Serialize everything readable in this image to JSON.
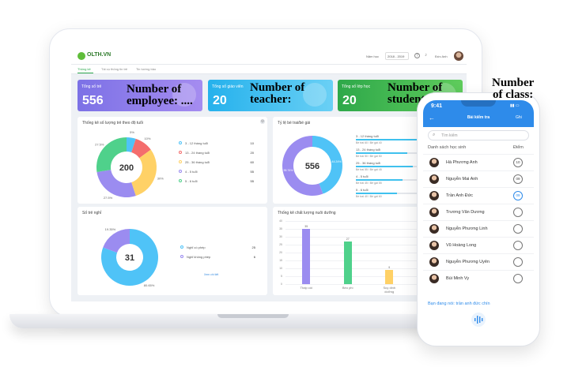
{
  "app": {
    "logo_text": "OLTH.VN",
    "school_year_label": "Năm học",
    "school_year_value": "2018 - 2019",
    "user_name": "Đức Anh",
    "tabs": [
      "Thông kê",
      "Tài vụ thông tin trẻ",
      "Tin tường bảo"
    ]
  },
  "cards": [
    {
      "label": "Tổng số trẻ",
      "value": "556",
      "color": "#7c71e6"
    },
    {
      "label": "Tổng số giáo viên",
      "value": "20",
      "color": "#25b1ec"
    },
    {
      "label": "Tổng số lớp học",
      "value": "20",
      "color": "#2ea84a"
    }
  ],
  "annotations": {
    "employee": [
      "Number of",
      "employee: ...."
    ],
    "teacher": [
      "Number of",
      "teacher:"
    ],
    "student": [
      "Number of",
      "student"
    ],
    "class": [
      "Number",
      "of class:"
    ]
  },
  "panels": {
    "age_title": "Thống kê số lượng trẻ theo độ tuổi",
    "ratio_title": "Tỷ lệ bé trai/bé gái",
    "absent_title": "Số trẻ nghỉ",
    "nutrition_title": "Thống kê chất lượng nuôi dưỡng",
    "absent_link": "Xem chi tiết"
  },
  "chart_data": [
    {
      "type": "pie",
      "title": "Thống kê số lượng trẻ theo độ tuổi",
      "center_label": "200",
      "categories": [
        "3 - 12 tháng tuổi",
        "13 - 24 tháng tuổi",
        "25 - 36 tháng tuổi",
        "4 - 5 tuổi",
        "5 - 6 tuổi"
      ],
      "values": [
        10,
        20,
        60,
        55,
        55
      ],
      "slice_labels": [
        "5%",
        "10%",
        "30%",
        "27.5%",
        "27.5%"
      ],
      "colors": [
        "#4fc3f7",
        "#f46d6d",
        "#ffd166",
        "#9b8cf0",
        "#4fd18b"
      ],
      "legend": "right"
    },
    {
      "type": "pie",
      "title": "Tỷ lệ bé trai/bé gái",
      "center_label": "556",
      "categories": [
        "Bé trai",
        "Bé gái"
      ],
      "values": [
        44.24,
        55.76
      ],
      "slice_labels": [
        "44.24%",
        "55.76%"
      ],
      "colors": [
        "#4fc3f7",
        "#9b8cf0"
      ],
      "rows": [
        {
          "label": "3 - 12 tháng tuổi",
          "sub": "Bé trai 60 / Bé gái 40",
          "fill": 0.6
        },
        {
          "label": "13 - 24 tháng tuổi",
          "sub": "Bé trai 50 / Bé gái 50",
          "fill": 0.5
        },
        {
          "label": "25 - 36 tháng tuổi",
          "sub": "Bé trai 55 / Bé gái 45",
          "fill": 0.55
        },
        {
          "label": "4 - 5 tuổi",
          "sub": "Bé trai 45 / Bé gái 55",
          "fill": 0.45
        },
        {
          "label": "5 - 6 tuổi",
          "sub": "Bé trai 40 / Bé gái 60",
          "fill": 0.4
        }
      ]
    },
    {
      "type": "pie",
      "title": "Số trẻ nghỉ",
      "center_label": "31",
      "categories": [
        "Nghỉ có phép",
        "Nghỉ không phép"
      ],
      "values": [
        25,
        6
      ],
      "slice_labels": [
        "80.65%",
        "19.35%"
      ],
      "colors": [
        "#4fc3f7",
        "#9b8cf0"
      ],
      "legend": "right"
    },
    {
      "type": "bar",
      "title": "Thống kê chất lượng nuôi dưỡng",
      "categories": [
        "Thấp còi",
        "Béo phì",
        "Suy dinh dưỡng",
        "Bình thường"
      ],
      "values": [
        35,
        27,
        9,
        5
      ],
      "colors": [
        "#9b8cf0",
        "#4fd18b",
        "#ffd166",
        "#4fc3f7"
      ],
      "yticks": [
        "0",
        "5",
        "10",
        "15",
        "20",
        "25",
        "30",
        "35",
        "40"
      ],
      "ylim": [
        0,
        40
      ]
    }
  ],
  "phone": {
    "time": "9:41",
    "title": "Bài kiểm tra",
    "action": "Ghi",
    "search_placeholder": "Tìm kiếm",
    "list_header": "Danh sách học sinh",
    "score_header": "Điểm",
    "students": [
      {
        "name": "Hà Phương Anh",
        "score": "10",
        "selected": false
      },
      {
        "name": "Nguyễn Mai Anh",
        "score": "09",
        "selected": false
      },
      {
        "name": "Trần Anh Đức",
        "score": "09",
        "selected": true
      },
      {
        "name": "Trương Văn Dương",
        "score": "",
        "selected": false
      },
      {
        "name": "Nguyễn Phương Linh",
        "score": "",
        "selected": false
      },
      {
        "name": "Vũ Hoàng Long",
        "score": "",
        "selected": false
      },
      {
        "name": "Nguyễn Phương Uyên",
        "score": "",
        "selected": false
      },
      {
        "name": "Bùi Minh Vy",
        "score": "",
        "selected": false
      }
    ],
    "voice_text": "Bạn đang nói: trần anh đức chín"
  }
}
